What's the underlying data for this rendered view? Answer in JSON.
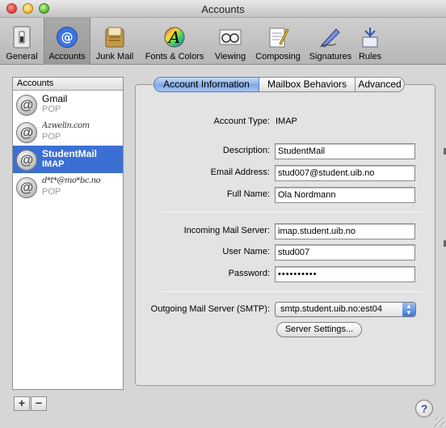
{
  "window": {
    "title": "Accounts"
  },
  "toolbar": {
    "items": [
      {
        "label": "General",
        "icon": "switch-icon"
      },
      {
        "label": "Accounts",
        "icon": "at-sign-icon",
        "selected": true
      },
      {
        "label": "Junk Mail",
        "icon": "junk-mail-icon"
      },
      {
        "label": "Fonts & Colors",
        "icon": "font-icon"
      },
      {
        "label": "Viewing",
        "icon": "glasses-icon"
      },
      {
        "label": "Composing",
        "icon": "notepad-pencil-icon"
      },
      {
        "label": "Signatures",
        "icon": "pen-icon"
      },
      {
        "label": "Rules",
        "icon": "rules-icon"
      }
    ]
  },
  "sidebar": {
    "header": "Accounts",
    "accounts": [
      {
        "name": "Gmail",
        "type": "POP"
      },
      {
        "name": "Azwelin.com",
        "type": "POP"
      },
      {
        "name": "StudentMail",
        "type": "IMAP",
        "selected": true
      },
      {
        "name": "d*t*@mo*bc.no",
        "type": "POP"
      }
    ],
    "add_label": "+",
    "remove_label": "−"
  },
  "tabs": [
    {
      "label": "Account Information",
      "active": true
    },
    {
      "label": "Mailbox Behaviors"
    },
    {
      "label": "Advanced"
    }
  ],
  "form": {
    "account_type_label": "Account Type:",
    "account_type_value": "IMAP",
    "description_label": "Description:",
    "description_value": "StudentMail",
    "email_label": "Email Address:",
    "email_value": "stud007@student.uib.no",
    "fullname_label": "Full Name:",
    "fullname_value": "Ola Nordmann",
    "incoming_label": "Incoming Mail Server:",
    "incoming_value": "imap.student.uib.no",
    "username_label": "User Name:",
    "username_value": "stud007",
    "password_label": "Password:",
    "password_value": "••••••••••",
    "smtp_label": "Outgoing Mail Server (SMTP):",
    "smtp_value": "smtp.student.uib.no:est04",
    "server_settings_label": "Server Settings..."
  },
  "help_label": "?",
  "colors": {
    "selection": "#3b6fd4",
    "tab_active": "#7fa8e4"
  }
}
